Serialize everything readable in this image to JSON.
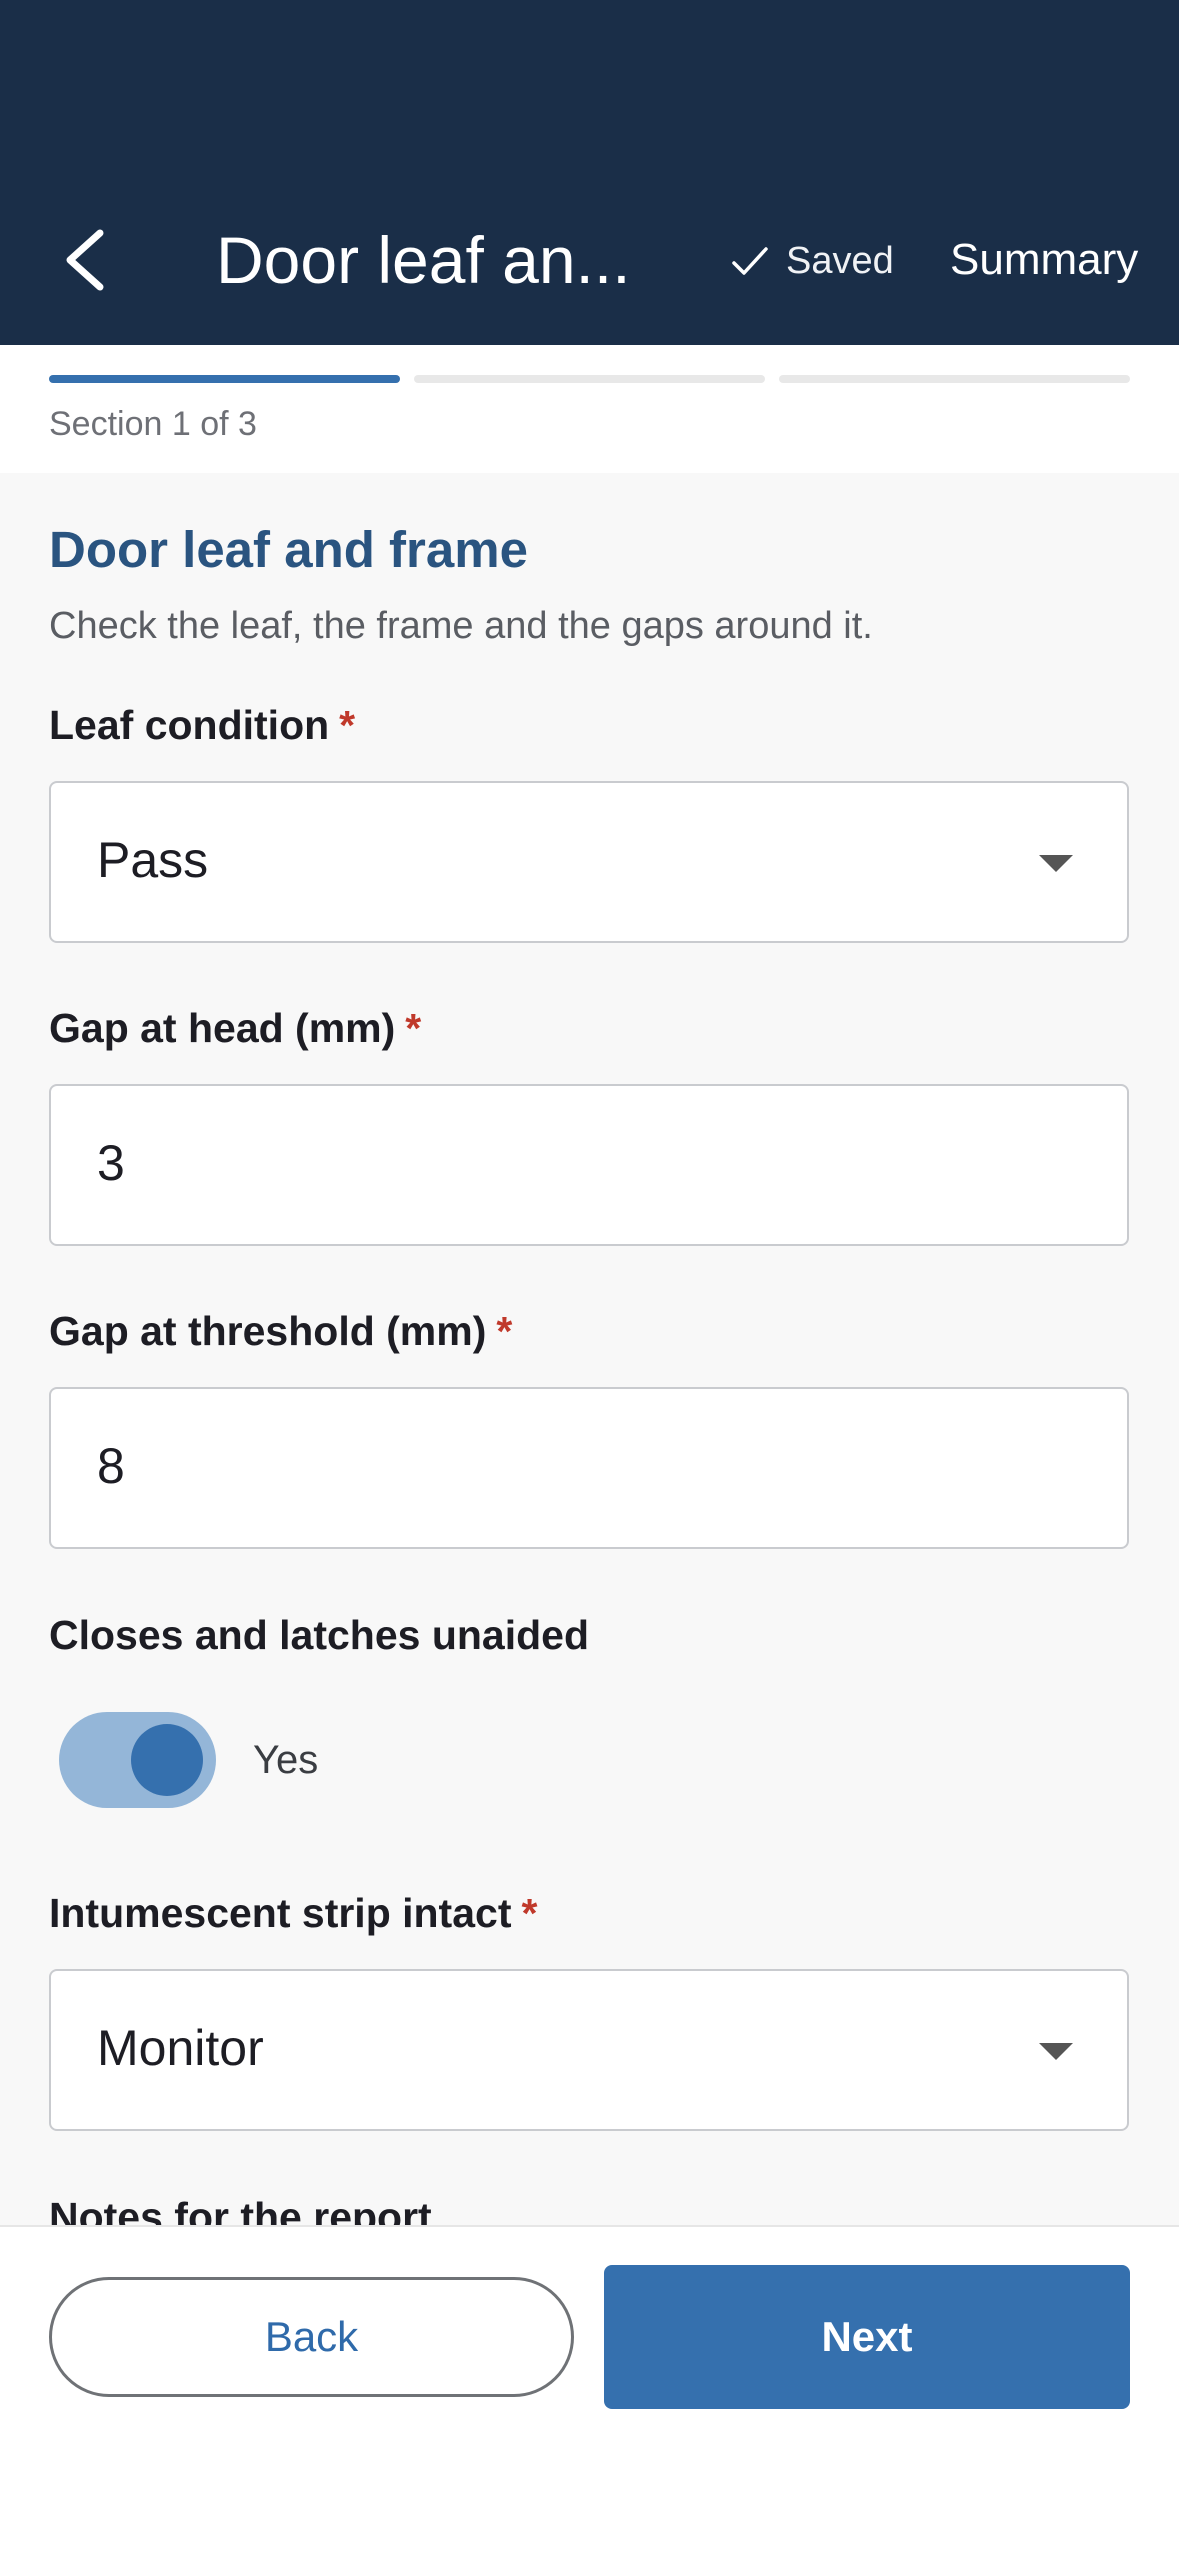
{
  "header": {
    "title": "Door leaf an...",
    "saved_label": "Saved",
    "summary_label": "Summary"
  },
  "progress": {
    "section_label": "Section 1 of 3",
    "current": 1,
    "total": 3
  },
  "section": {
    "title": "Door leaf and frame",
    "subtitle": "Check the leaf, the frame and the gaps around it."
  },
  "fields": {
    "leaf_condition": {
      "label": "Leaf condition",
      "required": "*",
      "value": "Pass"
    },
    "gap_head": {
      "label": "Gap at head (mm)",
      "required": "*",
      "value": "3"
    },
    "gap_threshold": {
      "label": "Gap at threshold (mm)",
      "required": "*",
      "value": "8"
    },
    "closes_latches": {
      "label": "Closes and latches unaided",
      "value": "Yes",
      "on": true
    },
    "intumescent": {
      "label": "Intumescent strip intact",
      "required": "*",
      "value": "Monitor"
    },
    "notes": {
      "label": "Notes for the report"
    }
  },
  "footer": {
    "back_label": "Back",
    "next_label": "Next"
  },
  "colors": {
    "header_bg": "#1a2e48",
    "accent": "#3570ae",
    "required": "#c0392b"
  }
}
